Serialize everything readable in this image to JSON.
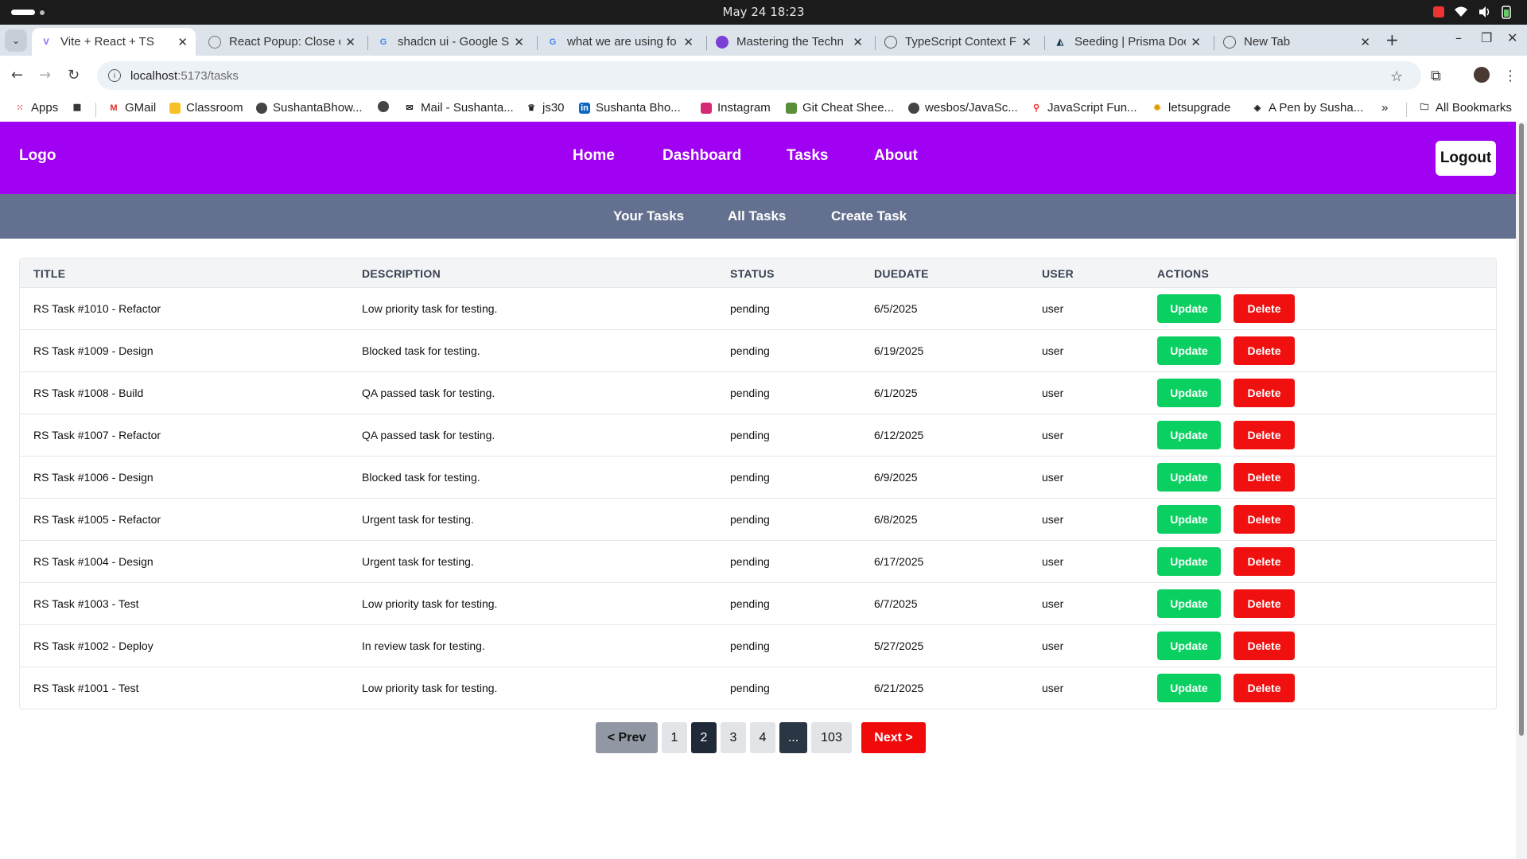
{
  "os": {
    "date": "May 24",
    "time": "18:23"
  },
  "tabs": [
    {
      "title": "Vite + React + TS",
      "favicon": "vite-icon",
      "active": true
    },
    {
      "title": "React Popup: Close o",
      "favicon": "react-icon",
      "active": false
    },
    {
      "title": "shadcn ui - Google Se",
      "favicon": "google-icon",
      "active": false
    },
    {
      "title": "what we are using fo",
      "favicon": "google-icon",
      "active": false
    },
    {
      "title": "Mastering the Techn",
      "favicon": "site-icon",
      "active": false
    },
    {
      "title": "TypeScript Context F",
      "favicon": "site-icon",
      "active": false
    },
    {
      "title": "Seeding | Prisma Doc",
      "favicon": "prisma-icon",
      "active": false
    },
    {
      "title": "New Tab",
      "favicon": "chrome-icon",
      "active": false
    }
  ],
  "address": {
    "host": "localhost",
    "path": ":5173/tasks"
  },
  "bookmarks": [
    "Apps",
    "GMail",
    "Classroom",
    "SushantaBhow...",
    "Mail - Sushanta...",
    "js30",
    "Sushanta Bho...",
    "Instagram",
    "Git Cheat Shee...",
    "wesbos/JavaSc...",
    "JavaScript Fun...",
    "letsupgrade",
    "A Pen by Susha...",
    "All Bookmarks"
  ],
  "nav": {
    "logo": "Logo",
    "links": [
      "Home",
      "Dashboard",
      "Tasks",
      "About"
    ],
    "logout": "Logout"
  },
  "subnav": [
    "Your Tasks",
    "All Tasks",
    "Create Task"
  ],
  "table": {
    "headers": [
      "TITLE",
      "DESCRIPTION",
      "STATUS",
      "DUEDATE",
      "USER",
      "ACTIONS"
    ],
    "update_label": "Update",
    "delete_label": "Delete",
    "rows": [
      {
        "title": "RS Task #1010 - Refactor",
        "description": "Low priority task for testing.",
        "status": "pending",
        "duedate": "6/5/2025",
        "user": "user"
      },
      {
        "title": "RS Task #1009 - Design",
        "description": "Blocked task for testing.",
        "status": "pending",
        "duedate": "6/19/2025",
        "user": "user"
      },
      {
        "title": "RS Task #1008 - Build",
        "description": "QA passed task for testing.",
        "status": "pending",
        "duedate": "6/1/2025",
        "user": "user"
      },
      {
        "title": "RS Task #1007 - Refactor",
        "description": "QA passed task for testing.",
        "status": "pending",
        "duedate": "6/12/2025",
        "user": "user"
      },
      {
        "title": "RS Task #1006 - Design",
        "description": "Blocked task for testing.",
        "status": "pending",
        "duedate": "6/9/2025",
        "user": "user"
      },
      {
        "title": "RS Task #1005 - Refactor",
        "description": "Urgent task for testing.",
        "status": "pending",
        "duedate": "6/8/2025",
        "user": "user"
      },
      {
        "title": "RS Task #1004 - Design",
        "description": "Urgent task for testing.",
        "status": "pending",
        "duedate": "6/17/2025",
        "user": "user"
      },
      {
        "title": "RS Task #1003 - Test",
        "description": "Low priority task for testing.",
        "status": "pending",
        "duedate": "6/7/2025",
        "user": "user"
      },
      {
        "title": "RS Task #1002 - Deploy",
        "description": "In review task for testing.",
        "status": "pending",
        "duedate": "5/27/2025",
        "user": "user"
      },
      {
        "title": "RS Task #1001 - Test",
        "description": "Low priority task for testing.",
        "status": "pending",
        "duedate": "6/21/2025",
        "user": "user"
      }
    ]
  },
  "pagination": {
    "prev": "< Prev",
    "pages": [
      "1",
      "2",
      "3",
      "4",
      "...",
      "103"
    ],
    "current": "2",
    "next": "Next >"
  },
  "colors": {
    "nav_bg": "#a001f2",
    "subnav_bg": "#64708f",
    "update_btn": "#0ad061",
    "delete_btn": "#f01010",
    "next_btn": "#f10a0a"
  }
}
